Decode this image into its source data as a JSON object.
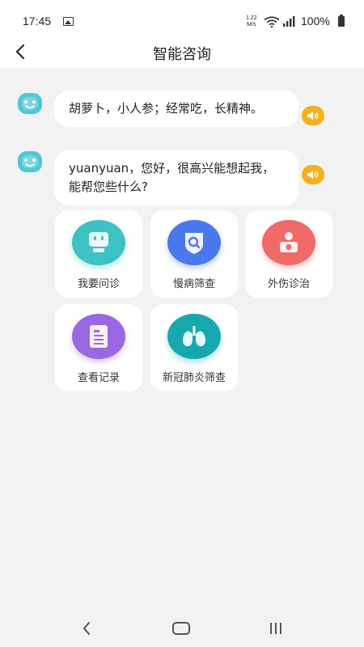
{
  "status_bar": {
    "time": "17:45",
    "net_speed_top": "1.22",
    "net_speed_bottom": "M/s",
    "battery": "100%"
  },
  "header": {
    "title": "智能咨询"
  },
  "messages": [
    {
      "text": "胡萝卜，小人参；经常吃，长精神。"
    },
    {
      "text": "yuanyuan，您好，很高兴能想起我，能帮您些什么?"
    }
  ],
  "actions": [
    {
      "label": "我要问诊",
      "icon": "robot-icon"
    },
    {
      "label": "慢病筛查",
      "icon": "search-shield-icon"
    },
    {
      "label": "外伤诊治",
      "icon": "patient-icon"
    },
    {
      "label": "查看记录",
      "icon": "document-icon"
    },
    {
      "label": "新冠肺炎筛查",
      "icon": "lungs-icon"
    }
  ],
  "colors": {
    "speaker": "#f5b01e",
    "avatar": "#4ec7d6",
    "consult": "#3cc1c4",
    "chronic": "#4a78ee",
    "trauma": "#ef6a68",
    "records": "#9968e2",
    "covid": "#17a8ae"
  }
}
